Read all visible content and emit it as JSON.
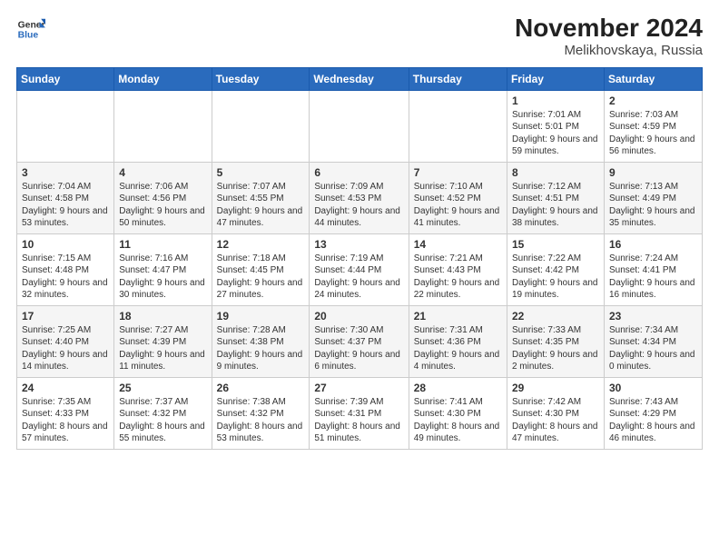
{
  "logo": {
    "line1": "General",
    "line2": "Blue"
  },
  "title": "November 2024",
  "subtitle": "Melikhovskaya, Russia",
  "days_header": [
    "Sunday",
    "Monday",
    "Tuesday",
    "Wednesday",
    "Thursday",
    "Friday",
    "Saturday"
  ],
  "weeks": [
    [
      {
        "day": "",
        "info": ""
      },
      {
        "day": "",
        "info": ""
      },
      {
        "day": "",
        "info": ""
      },
      {
        "day": "",
        "info": ""
      },
      {
        "day": "",
        "info": ""
      },
      {
        "day": "1",
        "info": "Sunrise: 7:01 AM\nSunset: 5:01 PM\nDaylight: 9 hours and 59 minutes."
      },
      {
        "day": "2",
        "info": "Sunrise: 7:03 AM\nSunset: 4:59 PM\nDaylight: 9 hours and 56 minutes."
      }
    ],
    [
      {
        "day": "3",
        "info": "Sunrise: 7:04 AM\nSunset: 4:58 PM\nDaylight: 9 hours and 53 minutes."
      },
      {
        "day": "4",
        "info": "Sunrise: 7:06 AM\nSunset: 4:56 PM\nDaylight: 9 hours and 50 minutes."
      },
      {
        "day": "5",
        "info": "Sunrise: 7:07 AM\nSunset: 4:55 PM\nDaylight: 9 hours and 47 minutes."
      },
      {
        "day": "6",
        "info": "Sunrise: 7:09 AM\nSunset: 4:53 PM\nDaylight: 9 hours and 44 minutes."
      },
      {
        "day": "7",
        "info": "Sunrise: 7:10 AM\nSunset: 4:52 PM\nDaylight: 9 hours and 41 minutes."
      },
      {
        "day": "8",
        "info": "Sunrise: 7:12 AM\nSunset: 4:51 PM\nDaylight: 9 hours and 38 minutes."
      },
      {
        "day": "9",
        "info": "Sunrise: 7:13 AM\nSunset: 4:49 PM\nDaylight: 9 hours and 35 minutes."
      }
    ],
    [
      {
        "day": "10",
        "info": "Sunrise: 7:15 AM\nSunset: 4:48 PM\nDaylight: 9 hours and 32 minutes."
      },
      {
        "day": "11",
        "info": "Sunrise: 7:16 AM\nSunset: 4:47 PM\nDaylight: 9 hours and 30 minutes."
      },
      {
        "day": "12",
        "info": "Sunrise: 7:18 AM\nSunset: 4:45 PM\nDaylight: 9 hours and 27 minutes."
      },
      {
        "day": "13",
        "info": "Sunrise: 7:19 AM\nSunset: 4:44 PM\nDaylight: 9 hours and 24 minutes."
      },
      {
        "day": "14",
        "info": "Sunrise: 7:21 AM\nSunset: 4:43 PM\nDaylight: 9 hours and 22 minutes."
      },
      {
        "day": "15",
        "info": "Sunrise: 7:22 AM\nSunset: 4:42 PM\nDaylight: 9 hours and 19 minutes."
      },
      {
        "day": "16",
        "info": "Sunrise: 7:24 AM\nSunset: 4:41 PM\nDaylight: 9 hours and 16 minutes."
      }
    ],
    [
      {
        "day": "17",
        "info": "Sunrise: 7:25 AM\nSunset: 4:40 PM\nDaylight: 9 hours and 14 minutes."
      },
      {
        "day": "18",
        "info": "Sunrise: 7:27 AM\nSunset: 4:39 PM\nDaylight: 9 hours and 11 minutes."
      },
      {
        "day": "19",
        "info": "Sunrise: 7:28 AM\nSunset: 4:38 PM\nDaylight: 9 hours and 9 minutes."
      },
      {
        "day": "20",
        "info": "Sunrise: 7:30 AM\nSunset: 4:37 PM\nDaylight: 9 hours and 6 minutes."
      },
      {
        "day": "21",
        "info": "Sunrise: 7:31 AM\nSunset: 4:36 PM\nDaylight: 9 hours and 4 minutes."
      },
      {
        "day": "22",
        "info": "Sunrise: 7:33 AM\nSunset: 4:35 PM\nDaylight: 9 hours and 2 minutes."
      },
      {
        "day": "23",
        "info": "Sunrise: 7:34 AM\nSunset: 4:34 PM\nDaylight: 9 hours and 0 minutes."
      }
    ],
    [
      {
        "day": "24",
        "info": "Sunrise: 7:35 AM\nSunset: 4:33 PM\nDaylight: 8 hours and 57 minutes."
      },
      {
        "day": "25",
        "info": "Sunrise: 7:37 AM\nSunset: 4:32 PM\nDaylight: 8 hours and 55 minutes."
      },
      {
        "day": "26",
        "info": "Sunrise: 7:38 AM\nSunset: 4:32 PM\nDaylight: 8 hours and 53 minutes."
      },
      {
        "day": "27",
        "info": "Sunrise: 7:39 AM\nSunset: 4:31 PM\nDaylight: 8 hours and 51 minutes."
      },
      {
        "day": "28",
        "info": "Sunrise: 7:41 AM\nSunset: 4:30 PM\nDaylight: 8 hours and 49 minutes."
      },
      {
        "day": "29",
        "info": "Sunrise: 7:42 AM\nSunset: 4:30 PM\nDaylight: 8 hours and 47 minutes."
      },
      {
        "day": "30",
        "info": "Sunrise: 7:43 AM\nSunset: 4:29 PM\nDaylight: 8 hours and 46 minutes."
      }
    ]
  ]
}
